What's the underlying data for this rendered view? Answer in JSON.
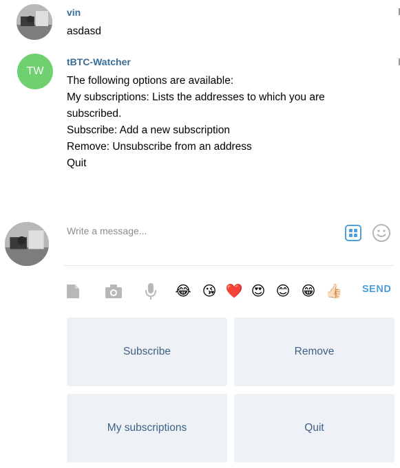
{
  "messages": [
    {
      "sender": "vin",
      "lines": [
        "asdasd"
      ],
      "avatar": "user-photo"
    },
    {
      "sender": "tBTC-Watcher",
      "avatar_initials": "TW",
      "avatar_color": "#6fd06f",
      "lines": [
        "The following options are available:",
        "My subscriptions: Lists the addresses to which you are",
        "subscribed.",
        "Subscribe: Add a new subscription",
        "Remove: Unsubscribe from an address",
        "Quit"
      ]
    }
  ],
  "composer": {
    "placeholder": "Write a message...",
    "send_label": "SEND",
    "icons": [
      "bot-keyboard-icon",
      "smiley-icon",
      "file-icon",
      "camera-icon",
      "microphone-icon"
    ]
  },
  "emojis": [
    "😂",
    "😘",
    "❤️",
    "😍",
    "😊",
    "😁",
    "👍🏻"
  ],
  "keyboard": {
    "buttons": [
      "Subscribe",
      "Remove",
      "My subscriptions",
      "Quit"
    ]
  },
  "colors": {
    "sender_name": "#3a6d99",
    "send": "#4e9ed8",
    "keyboard_button_bg": "#eef1f5",
    "keyboard_button_text": "#3e5f85"
  }
}
